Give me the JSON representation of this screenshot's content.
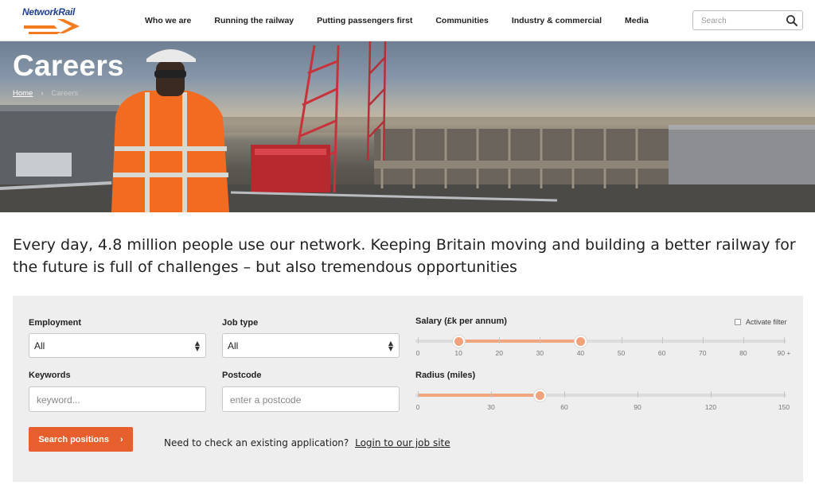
{
  "brand": {
    "name": "NetworkRail",
    "accent": "#e65f2c",
    "navy": "#1f3f8f"
  },
  "nav": {
    "items": [
      "Who we are",
      "Running the railway",
      "Putting passengers first",
      "Communities",
      "Industry & commercial",
      "Media"
    ]
  },
  "search": {
    "placeholder": "Search",
    "icon": "search-icon"
  },
  "hero": {
    "title": "Careers",
    "breadcrumb": {
      "home": "Home",
      "separator": "›",
      "current": "Careers"
    }
  },
  "intro": "Every day, 4.8 million people use our network. Keeping Britain moving and building a better railway for the future is full of challenges – but also tremendous opportunities",
  "form": {
    "employment": {
      "label": "Employment",
      "value": "All"
    },
    "job_type": {
      "label": "Job type",
      "value": "All"
    },
    "keywords": {
      "label": "Keywords",
      "placeholder": "keyword..."
    },
    "postcode": {
      "label": "Postcode",
      "placeholder": "enter a postcode"
    },
    "salary": {
      "label": "Salary (£k per annum)",
      "activate_filter": "Activate filter",
      "activate_filter_checked": false,
      "min": 0,
      "max": 90,
      "selected_low": 10,
      "selected_high": 40,
      "ticks": [
        "0",
        "10",
        "20",
        "30",
        "40",
        "50",
        "60",
        "70",
        "80",
        "90 +"
      ]
    },
    "radius": {
      "label": "Radius (miles)",
      "min": 0,
      "max": 150,
      "selected": 50,
      "ticks": [
        "0",
        "30",
        "60",
        "90",
        "120",
        "150"
      ]
    },
    "submit_label": "Search positions",
    "submit_chevron": "›",
    "existing_text": "Need to check an existing application?",
    "existing_link": "Login to our job site"
  }
}
